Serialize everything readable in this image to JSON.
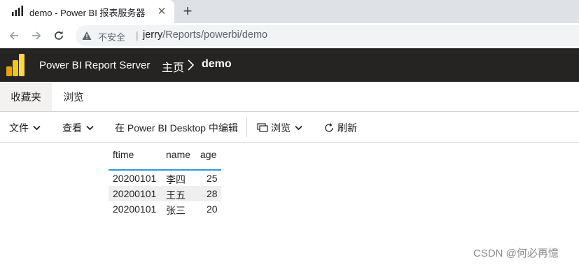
{
  "browser": {
    "tab_title": "demo - Power BI 报表服务器",
    "close_glyph": "✕",
    "new_tab_glyph": "+",
    "security_label": "不安全",
    "url_separator": "|",
    "url_host": "jerry",
    "url_path": "/Reports/powerbi/demo"
  },
  "header": {
    "product_name": "Power BI Report Server",
    "breadcrumb_home": "主页",
    "breadcrumb_current": "demo",
    "logo_color": "#f2c811"
  },
  "subnav": {
    "tabs": [
      {
        "label": "收藏夹",
        "active": true
      },
      {
        "label": "浏览",
        "active": false
      }
    ]
  },
  "commands": {
    "file": "文件",
    "view": "查看",
    "edit": "在 Power BI Desktop 中编辑",
    "browse": "浏览",
    "refresh": "刷新"
  },
  "table": {
    "columns": [
      "ftime",
      "name",
      "age"
    ],
    "rows": [
      [
        "20200101",
        "李四",
        "25"
      ],
      [
        "20200101",
        "王五",
        "28"
      ],
      [
        "20200101",
        "张三",
        "20"
      ]
    ],
    "accent_color": "#2b9bd3"
  },
  "watermark": "CSDN @何必再憶"
}
